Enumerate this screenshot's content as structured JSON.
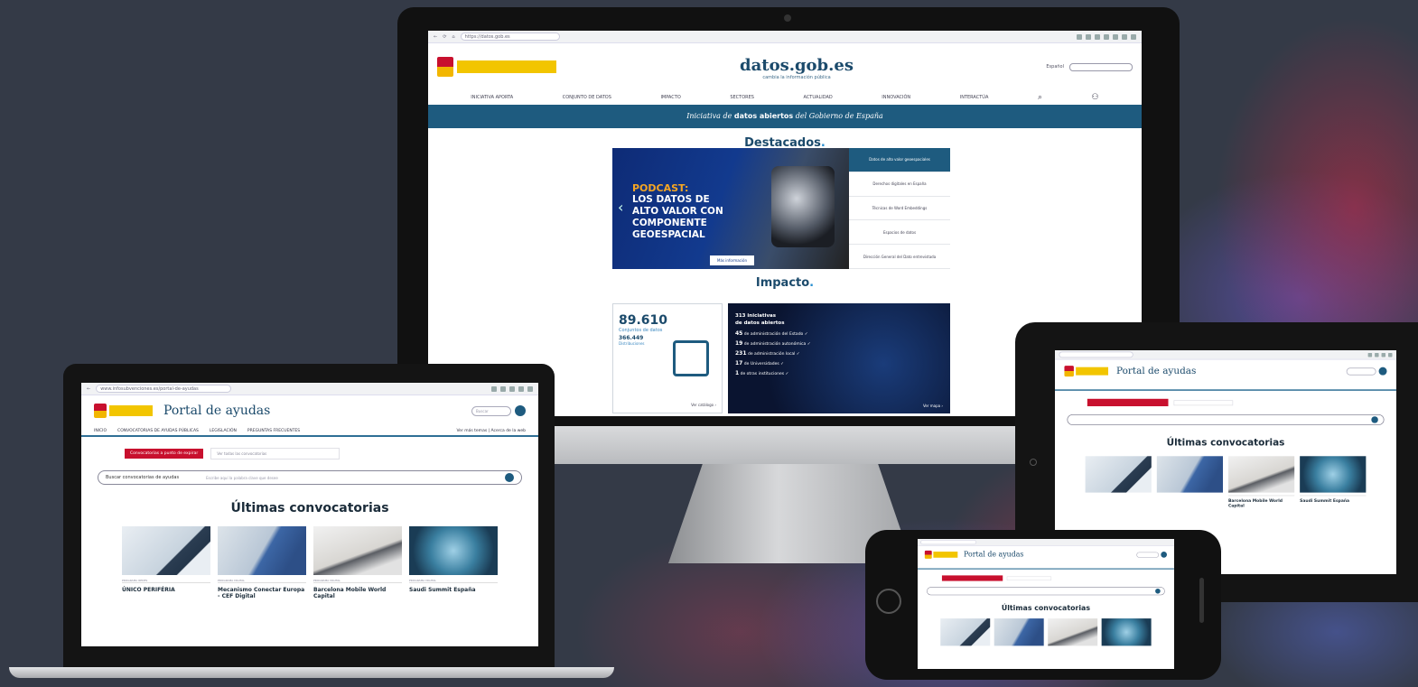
{
  "colors": {
    "brand_blue": "#1e5b7f",
    "accent_red": "#c8102e",
    "gov_yellow": "#f2c500"
  },
  "monitor": {
    "url": "https://datos.gob.es",
    "lang": "Español",
    "logo_main": "datos.gob.es",
    "logo_sub": "cambia la información pública",
    "nav": [
      "INICIATIVA APORTA",
      "CONJUNTO DE DATOS",
      "IMPACTO",
      "SECTORES",
      "ACTUALIDAD",
      "INNOVACIÓN",
      "INTERACTÚA"
    ],
    "banner_pre": "Iniciativa de",
    "banner_bold": "datos abiertos",
    "banner_post": "del Gobierno de España",
    "featured_title": "Destacados",
    "podcast_label": "PODCAST:",
    "podcast_title": "LOS DATOS DE\nALTO VALOR CON\nCOMPONENTE\nGEOESPACIAL",
    "featured_more": "Más información",
    "featured_items": [
      "Datos de alto valor geoespaciales",
      "Derechos digitales en España",
      "Técnicas de Word Embeddings",
      "Espacios de datos",
      "Dirección General del Dato entrevistada"
    ],
    "impact_title": "Impacto",
    "datasets_count": "89.610",
    "datasets_label": "Conjuntos de datos",
    "distributions_count": "366.449",
    "distributions_label": "Distribuciones",
    "impact_link_left": "Ver catálogo",
    "initiatives_head": "313 iniciativas\nde datos abiertos",
    "initiatives": [
      {
        "num": "45",
        "label": "de administración del Estado"
      },
      {
        "num": "19",
        "de": "",
        "label": "de administración autonómica"
      },
      {
        "num": "231",
        "label": "de administración local"
      },
      {
        "num": "17",
        "label": "de Universidades"
      },
      {
        "num": "1",
        "label": "de otras instituciones"
      }
    ],
    "impact_link_right": "Ver mapa"
  },
  "laptop": {
    "url": "www.infosubvenciones.es/portal-de-ayudas",
    "portal_title": "Portal de ayudas",
    "search_placeholder": "Buscar",
    "nav": [
      "INICIO",
      "CONVOCATORIAS DE AYUDAS PÚBLICAS",
      "LEGISLACIÓN",
      "PREGUNTAS FRECUENTES"
    ],
    "nav_right": "Ver más temas | Acerca de la web",
    "red_tag": "Convocatorias a punto de expirar",
    "red_text": "Ver todas las convocatorias",
    "searchbar_label": "Buscar convocatorias de ayudas",
    "searchbar_placeholder": "Escribe aquí la palabra clave que desee",
    "latest_title": "Últimas convocatorias",
    "cards": [
      {
        "meta": "PROGRAMA REDES",
        "name": "ÚNICO PERIFÉRIA"
      },
      {
        "meta": "PROGRAMA DIGITAL",
        "name": "Mecanismo Conectar Europa - CEF Digital"
      },
      {
        "meta": "PROGRAMA DIGITAL",
        "name": "Barcelona Mobile World Capital"
      },
      {
        "meta": "PROGRAMA DIGITAL",
        "name": "Saudi Summit España"
      }
    ]
  },
  "tablet": {
    "portal_title": "Portal de ayudas",
    "latest_title": "Últimas convocatorias",
    "cards": [
      {
        "name": "Barcelona Mobile World Capital"
      },
      {
        "name": "Saudi Summit España"
      }
    ]
  },
  "phone": {
    "portal_title": "Portal de ayudas",
    "latest_title": "Últimas convocatorias"
  }
}
